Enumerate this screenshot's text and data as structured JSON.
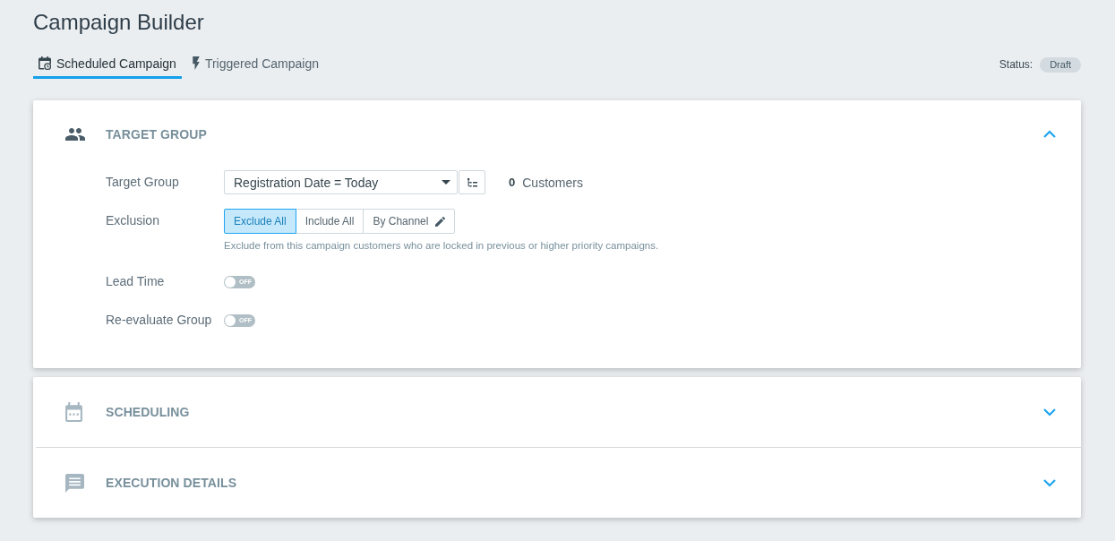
{
  "title": "Campaign Builder",
  "tabs": [
    {
      "label": "Scheduled Campaign",
      "kind": "scheduled",
      "selected": true
    },
    {
      "label": "Triggered Campaign",
      "kind": "triggered",
      "selected": false
    }
  ],
  "status": {
    "label": "Status:",
    "value": "Draft"
  },
  "sections": [
    {
      "title": "TARGET GROUP",
      "kind": "target_group",
      "expanded": true,
      "fields": [
        {
          "kind": "select",
          "label": "Target Group",
          "value": "Registration Date = Today",
          "count": "0",
          "count_label": "Customers"
        },
        {
          "kind": "segmented",
          "label": "Exclusion",
          "options": [
            {
              "label": "Exclude All",
              "kind": "plain",
              "selected": true
            },
            {
              "label": "Include All",
              "kind": "plain",
              "selected": false
            },
            {
              "label": "By Channel",
              "kind": "editable",
              "selected": false
            }
          ],
          "hint": "Exclude from this campaign customers who are locked in previous or higher priority campaigns."
        },
        {
          "kind": "toggle",
          "label": "Lead Time",
          "on": false,
          "state_text": "OFF"
        },
        {
          "kind": "toggle",
          "label": "Re-evaluate Group",
          "on": false,
          "state_text": "OFF"
        }
      ]
    },
    {
      "title": "SCHEDULING",
      "kind": "scheduling",
      "expanded": false
    },
    {
      "title": "EXECUTION DETAILS",
      "kind": "execution",
      "expanded": false
    }
  ]
}
